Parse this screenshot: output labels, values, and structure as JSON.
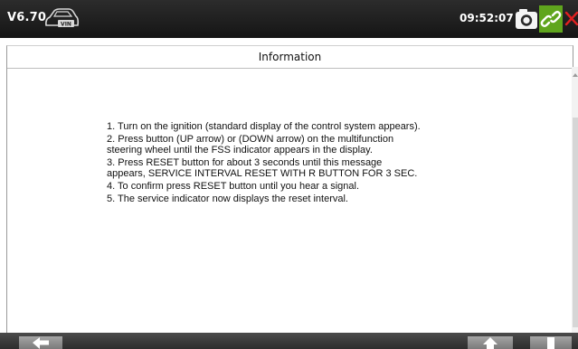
{
  "status_bar": {
    "version": "V6.70",
    "time": "09:52:07",
    "icons": {
      "vin": "vin-car-icon",
      "screenshot": "camera-icon",
      "connection": "link-icon",
      "close": "close-icon"
    },
    "colors": {
      "link_bg": "#5fa51d",
      "close": "#e02020"
    }
  },
  "panel": {
    "title": "Information",
    "paragraphs": [
      "1. Turn on the ignition (standard display of the control system appears).",
      "2. Press button (UP arrow) or (DOWN arrow) on the multifunction steering wheel until the FSS indicator appears in the display.",
      "3. Press RESET button for about 3 seconds until this message appears, SERVICE INTERVAL RESET WITH R BUTTON FOR 3 SEC.",
      "4. To confirm press RESET button until you hear a signal.",
      "5. The service indicator now displays the reset interval."
    ]
  },
  "bottom_bar": {
    "icons": {
      "back": "back-arrow-icon",
      "page_up": "arrow-up-icon",
      "page_down": "arrow-down-icon"
    }
  }
}
